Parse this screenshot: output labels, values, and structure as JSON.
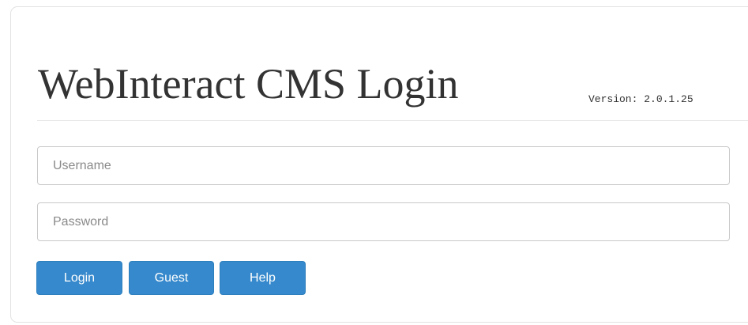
{
  "header": {
    "title": "WebInteract CMS Login",
    "version": "Version: 2.0.1.25"
  },
  "form": {
    "username_placeholder": "Username",
    "username_value": "",
    "password_placeholder": "Password",
    "password_value": ""
  },
  "buttons": {
    "login_label": "Login",
    "guest_label": "Guest",
    "help_label": "Help"
  },
  "colors": {
    "button_bg": "#3689cc",
    "button_text": "#ffffff",
    "title_text": "#333333"
  }
}
